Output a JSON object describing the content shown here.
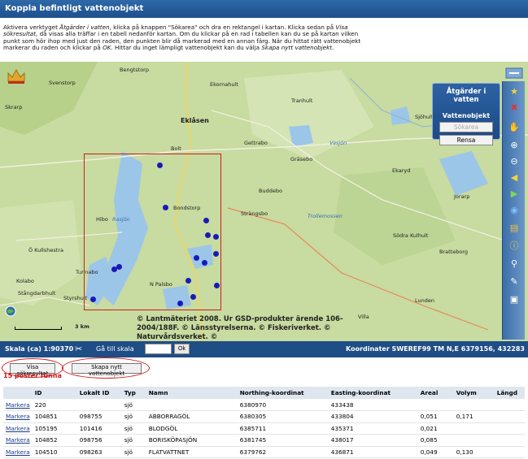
{
  "window": {
    "title": "Koppla befintligt vattenobjekt"
  },
  "instructions": {
    "p1": "Aktivera verktyget ",
    "p1_em": "Åtgärder i vatten",
    "p2": ", klicka på knappen \"Sökarea\" och dra en rektangel i kartan. Klicka sedan på ",
    "p2_em": "Visa sökresultat",
    "p3": ", då visas alla träffar i en tabell nedanför kartan. Om du klickar på en rad i tabellen kan du se på kartan vilken punkt som hör ihop med just den raden, den punkten blir då markerad med en annan färg. När du hittat rätt vattenobjekt markerar du raden och klickar på ",
    "p3_em": "OK",
    "p4": ". Hittar du inget lämpligt vattenobjekt kan du välja ",
    "p4_em": "Skapa nytt vattenobjekt",
    "p5": "."
  },
  "map": {
    "places": {
      "bengtstorp": "Bengtstorp",
      "svenstorp": "Svenstorp",
      "ekornahult": "Ekornahult",
      "skrarp": "Skrarp",
      "tranhult": "Tranhult",
      "sjohult": "Sjöhult",
      "eklasen": "Eklåsen",
      "bolt": "Bolt",
      "gettrabo": "Gettrabo",
      "grasebo": "Gräsebo",
      "vasjon": "Vasjön",
      "ekaryd": "Ekaryd",
      "bondstorp": "Bondstorp",
      "buddebo": "Buddebo",
      "jorarp": "Jorarp",
      "hibo": "Hibo",
      "rasjon": "Rasjön",
      "strangsbo": "Strängsbo",
      "trollemossen": "Trollemossen",
      "sodra_kulhult": "Södra Kulhult",
      "brattebor": "Bratteborg",
      "o_kullshestra": "Ö Kullshestra",
      "tunnabo": "Tunnabo",
      "kolabo": "Kolabo",
      "npalsbo": "N Palsbo",
      "stangdarbhult": "Stångdarbhult",
      "styrshult": "Styrshult",
      "lunden": "Lunden",
      "villa": "Villa"
    },
    "copyright": "© Lantmäteriet 2008. Ur GSD-produkter ärende 106-2004/188F. © Länsstyrelserna. © Fiskeriverket. © Naturvårdsverket. ©",
    "scalebar_label": "3 km",
    "toolbar_icons": [
      "star-icon",
      "delete-icon",
      "hand-pan-icon",
      "zoom-in-icon",
      "zoom-out-icon",
      "back-arrow-icon",
      "forward-arrow-icon",
      "globe-icon",
      "layers-icon",
      "info-icon",
      "search-icon",
      "measure-icon",
      "print-icon"
    ]
  },
  "action_panel": {
    "title": "Åtgärder i vatten",
    "subtitle": "Vattenobjekt",
    "search_area_button": "Sökarea",
    "clear_button": "Rensa"
  },
  "statusbar": {
    "scale": "Skala (ca) 1:90370",
    "goto_scale": "Gå till skala",
    "ok_button": "Ok",
    "coordinates": "Koordinater SWEREF99 TM N,E 6379156, 432283"
  },
  "buttons": {
    "show_results": "Visa sökresultat",
    "create_new": "Skapa nytt vattenobjekt"
  },
  "result_count": "15 poster funna",
  "table": {
    "headers": [
      "",
      "ID",
      "Lokalt ID",
      "Typ",
      "Namn",
      "Northing-koordinat",
      "Easting-koordinat",
      "Areal",
      "Volym",
      "Längd"
    ],
    "rows": [
      [
        "Markera",
        "220",
        "",
        "sjö",
        "",
        "6380970",
        "433438",
        "",
        "",
        ""
      ],
      [
        "Markera",
        "104851",
        "098755",
        "sjö",
        "ABBORRAGÖL",
        "6380305",
        "433804",
        "0,051",
        "0,171",
        ""
      ],
      [
        "Markera",
        "105195",
        "101416",
        "sjö",
        "BLODGÖL",
        "6385711",
        "435371",
        "0,021",
        "",
        ""
      ],
      [
        "Markera",
        "104852",
        "098756",
        "sjö",
        "BORISKÖPASJÖN",
        "6381745",
        "438017",
        "0,085",
        "",
        ""
      ],
      [
        "Markera",
        "104510",
        "098263",
        "sjö",
        "FLATVATTNET",
        "6379762",
        "436871",
        "0,049",
        "0,130",
        ""
      ]
    ]
  }
}
